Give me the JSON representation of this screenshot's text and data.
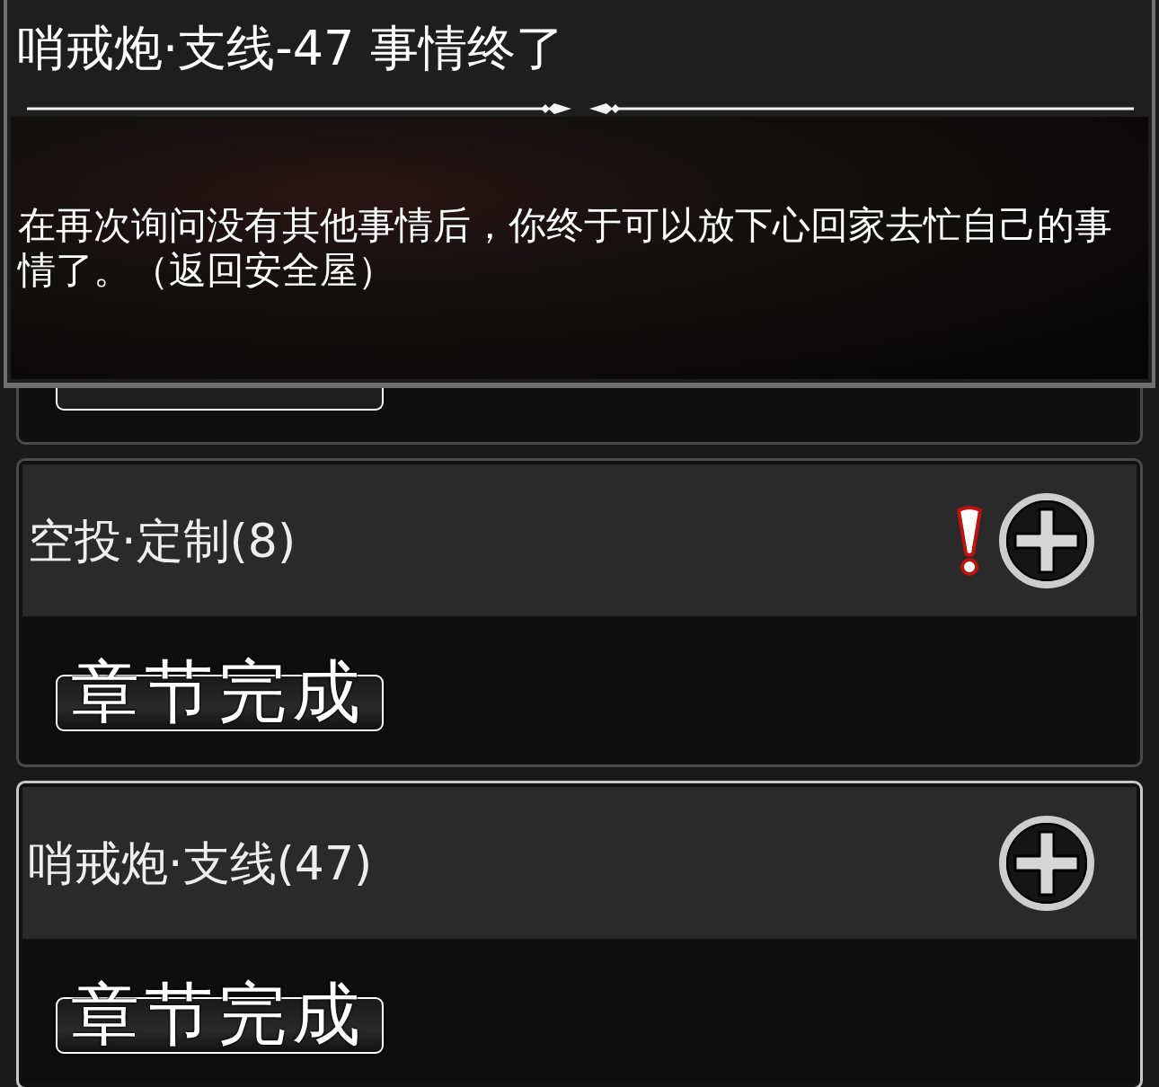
{
  "dialog": {
    "title": "哨戒炮·支线-47 事情终了",
    "message": "在再次询问没有其他事情后，你终于可以放下心回家去忙自己的事情了。（返回安全屋）"
  },
  "chapters": [
    {
      "kind": "clipped",
      "selected": false
    },
    {
      "kind": "full",
      "title": "空投·定制(8)",
      "alert": true,
      "selected": false,
      "stamp": "章节完成"
    },
    {
      "kind": "full",
      "title": "哨戒炮·支线(47)",
      "alert": false,
      "selected": true,
      "stamp": "章节完成"
    }
  ]
}
